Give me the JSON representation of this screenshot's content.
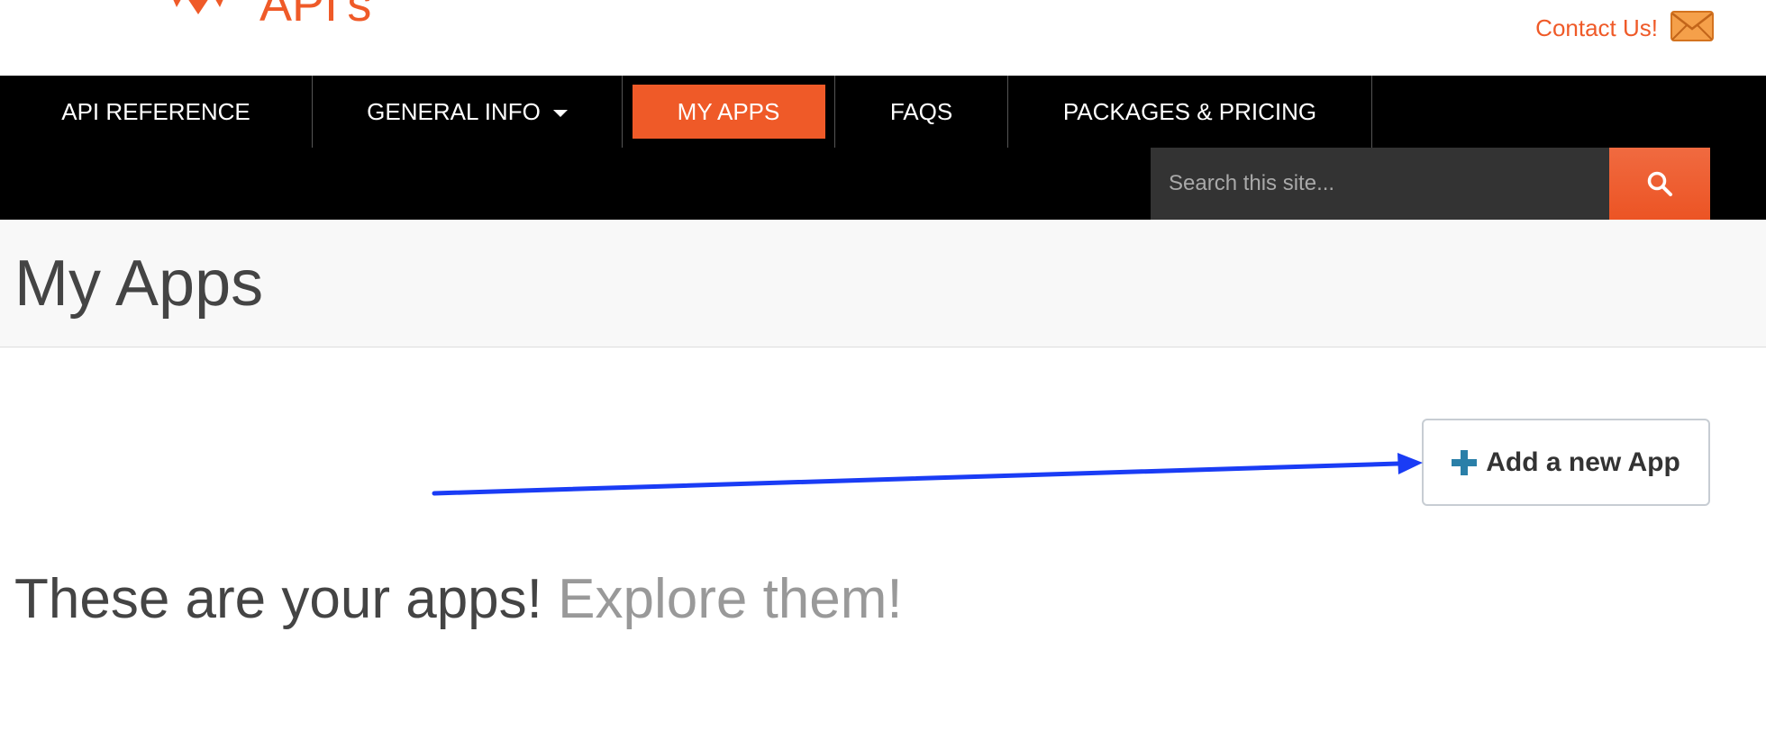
{
  "header": {
    "logo_text": "API's",
    "contact_label": "Contact Us!",
    "contact_icon": "envelope-icon"
  },
  "nav": {
    "items": [
      {
        "label": "API REFERENCE"
      },
      {
        "label": "GENERAL INFO"
      },
      {
        "label": "MY APPS"
      },
      {
        "label": "FAQS"
      },
      {
        "label": "PACKAGES & PRICING"
      }
    ],
    "active": "MY APPS",
    "search_placeholder": "Search this site...",
    "search_icon": "search-icon"
  },
  "page": {
    "title": "My Apps",
    "add_app_label": "Add a new App",
    "add_app_icon": "plus-icon",
    "intro_main": "These are your apps!",
    "intro_sub": "Explore them!"
  },
  "colors": {
    "brand_orange": "#ef5a28",
    "nav_bg": "#000000",
    "annotation_arrow": "#1a3cf5",
    "plus_icon": "#2a7fa8"
  }
}
